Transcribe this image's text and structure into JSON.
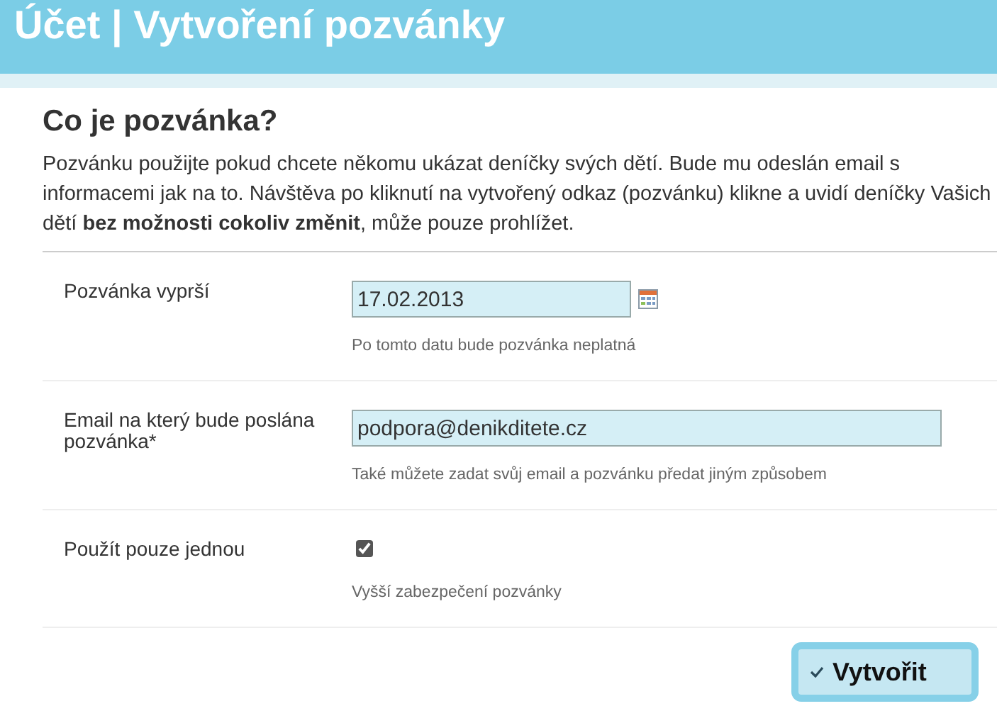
{
  "header": {
    "title": "Účet | Vytvoření pozvánky"
  },
  "section": {
    "heading": "Co je pozvánka?",
    "text": "Pozvánku použijte pokud chcete někomu ukázat deníčky svých dětí. Bude mu odeslán email s informacemi jak na to. Návštěva po kliknutí na vytvořený odkaz (pozvánku) klikne a uvidí deníčky Vašich dětí **bez možnosti cokoliv změnit**, může pouze prohlížet."
  },
  "fields": [
    {
      "kind": "date",
      "label": "Pozvánka vyprší",
      "value": "17.02.2013",
      "hint": "Po tomto datu bude pozvánka neplatná"
    },
    {
      "kind": "text",
      "label": "Email na který bude poslána pozvánka*",
      "value": "podpora@denikditete.cz",
      "hint": "Také můžete zadat svůj email a pozvánku předat jiným způsobem"
    },
    {
      "kind": "checkbox",
      "label": "Použít pouze jednou",
      "checked": true,
      "hint": "Vyšší zabezpečení pozvánky"
    }
  ],
  "submit": {
    "label": "Vytvořit"
  }
}
